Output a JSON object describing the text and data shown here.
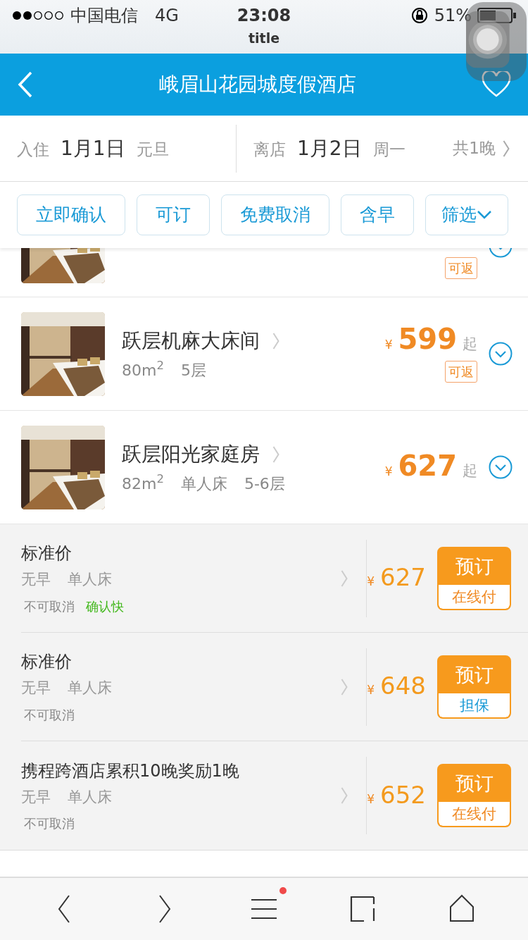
{
  "status_bar": {
    "carrier": "中国电信",
    "network": "4G",
    "time": "23:08",
    "battery": "51%"
  },
  "page_title": "title",
  "header": {
    "title": "峨眉山花园城度假酒店"
  },
  "dates": {
    "checkin_label": "入住",
    "checkin_date": "1月1日",
    "checkin_note": "元旦",
    "checkout_label": "离店",
    "checkout_date": "1月2日",
    "checkout_note": "周一",
    "nights": "共1晚"
  },
  "filters": [
    {
      "label": "立即确认",
      "kind": "chip",
      "selected": false
    },
    {
      "label": "可订",
      "kind": "chip",
      "selected": false
    },
    {
      "label": "免费取消",
      "kind": "chip",
      "selected": false
    },
    {
      "label": "含早",
      "kind": "chip",
      "selected": false
    },
    {
      "label": "筛选",
      "kind": "dropdown",
      "selected": false
    }
  ],
  "rooms": [
    {
      "kind": "partial",
      "badge": "可返"
    },
    {
      "kind": "full",
      "name": "跃层机麻大床间",
      "specs": [
        "80m$^{2}$",
        "5层"
      ],
      "currency": "¥",
      "price": "599",
      "suffix": "起",
      "badge": "可返"
    },
    {
      "kind": "full",
      "name": "跃层阳光家庭房",
      "specs": [
        "82m$^{2}$",
        "单人床",
        "5-6层"
      ],
      "currency": "¥",
      "price": "627",
      "suffix": "起"
    }
  ],
  "rates": [
    {
      "title": "标准价",
      "tags": [
        "无早",
        "单人床"
      ],
      "policies": [
        {
          "text": "不可取消",
          "kind": "normal"
        },
        {
          "text": "确认快",
          "kind": "highlight"
        }
      ],
      "currency": "¥",
      "price": "627",
      "book": "预订",
      "pay": "在线付",
      "kind": "online"
    },
    {
      "title": "标准价",
      "tags": [
        "无早",
        "单人床"
      ],
      "policies": [
        {
          "text": "不可取消",
          "kind": "normal"
        }
      ],
      "currency": "¥",
      "price": "648",
      "book": "预订",
      "pay": "担保",
      "kind": "guarantee"
    },
    {
      "title": "携程跨酒店累积10晚奖励1晚",
      "tags": [
        "无早",
        "单人床"
      ],
      "policies": [
        {
          "text": "不可取消",
          "kind": "normal"
        }
      ],
      "currency": "¥",
      "price": "652",
      "book": "预订",
      "pay": "在线付",
      "kind": "online"
    }
  ],
  "toolbar": [
    {
      "kind": "back",
      "has_dot": false
    },
    {
      "kind": "forward",
      "has_dot": false
    },
    {
      "kind": "menu",
      "has_dot": true
    },
    {
      "kind": "tabs",
      "has_dot": false
    },
    {
      "kind": "home",
      "has_dot": false
    }
  ]
}
